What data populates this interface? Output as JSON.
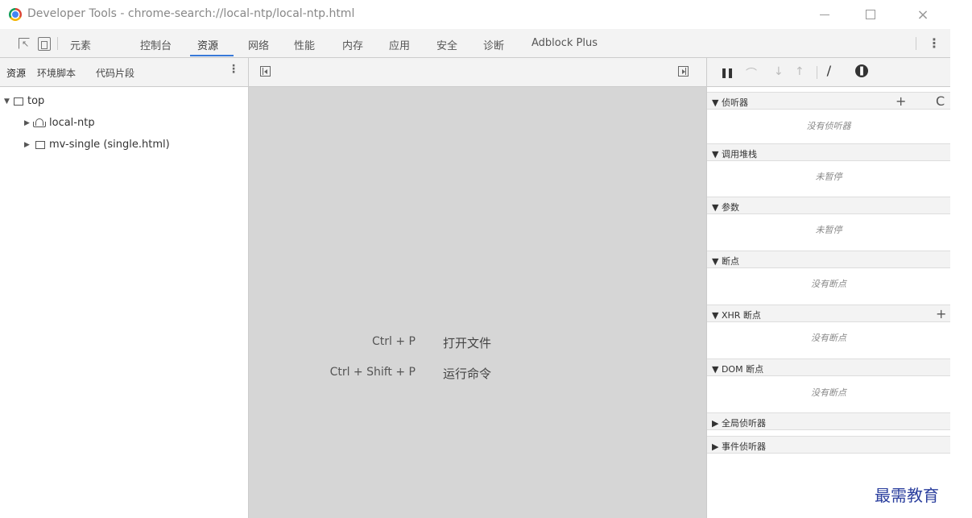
{
  "window": {
    "title": "Developer Tools - chrome-search://local-ntp/local-ntp.html",
    "close_glyph": "×"
  },
  "main_tabs": [
    "元素",
    "控制台",
    "资源",
    "网络",
    "性能",
    "内存",
    "应用",
    "安全",
    "诊断",
    "Adblock Plus"
  ],
  "main_tab_active": "资源",
  "sources_subtabs": [
    "资源",
    "环境脚本",
    "代码片段"
  ],
  "tree": [
    {
      "label": "top",
      "expanded": true,
      "icon": "frame-icon"
    },
    {
      "label": "local-ntp",
      "expanded": false,
      "icon": "cloud-icon"
    },
    {
      "label": "mv-single (single.html)",
      "expanded": false,
      "icon": "frame-icon"
    }
  ],
  "shortcuts": [
    {
      "key": "Ctrl + P",
      "label": "打开文件"
    },
    {
      "key": "Ctrl + Shift + P",
      "label": "运行命令"
    }
  ],
  "debugger": {
    "sections": [
      {
        "title": "▼ 侦听器",
        "body": "没有侦听器",
        "actions": [
          "+",
          "C"
        ]
      },
      {
        "title": "▼ 调用堆栈",
        "body": "未暂停"
      },
      {
        "title": "▼ 参数",
        "body": "未暂停"
      },
      {
        "title": "▼ 断点",
        "body": "没有断点"
      },
      {
        "title": "▼ XHR 断点",
        "body": "没有断点",
        "actions": [
          "+"
        ]
      },
      {
        "title": "▼ DOM 断点",
        "body": "没有断点"
      },
      {
        "title": "▶ 全局侦听器"
      },
      {
        "title": "▶ 事件侦听器"
      }
    ]
  },
  "watermark": "最需教育"
}
